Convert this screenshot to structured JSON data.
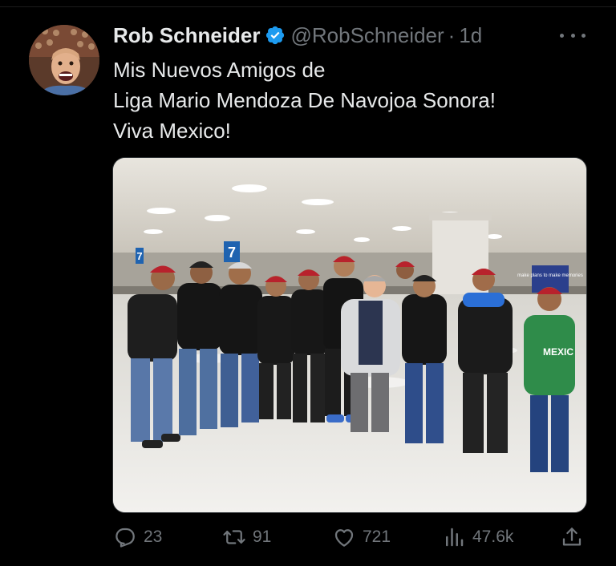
{
  "tweet": {
    "author_name": "Rob Schneider",
    "handle": "@RobSchneider",
    "separator": "·",
    "timestamp": "1d",
    "text_lines": [
      "Mis Nuevos Amigos de",
      "Liga Mario Mendoza De Navojoa Sonora!",
      "Viva Mexico!"
    ]
  },
  "metrics": {
    "replies": "23",
    "reposts": "91",
    "likes": "721",
    "views": "47.6k"
  },
  "photo": {
    "gate_sign": "7",
    "gate_sign_2": "7",
    "ad_text": "make plans to make memories",
    "jersey_text": "MEXIC"
  },
  "colors": {
    "background": "#000000",
    "text_primary": "#e7e9ea",
    "text_secondary": "#71767b",
    "verified_blue": "#1d9bf0"
  },
  "icons": {
    "verified": "verified-badge-icon",
    "more": "more-options-icon",
    "reply": "reply-icon",
    "repost": "repost-icon",
    "like": "heart-icon",
    "views": "views-chart-icon",
    "share": "share-icon"
  }
}
